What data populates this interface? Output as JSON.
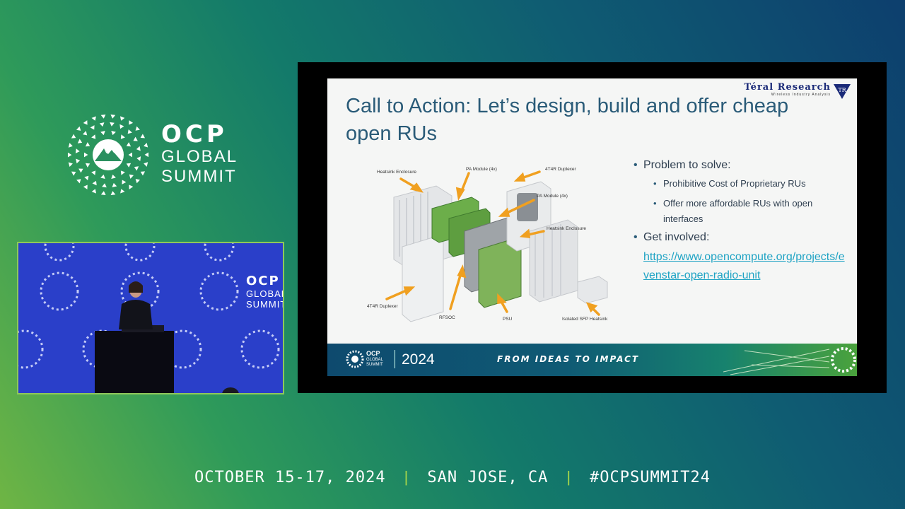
{
  "event_brand": {
    "name": "OCP",
    "line1": "GLOBAL",
    "line2": "SUMMIT"
  },
  "video": {
    "brand_name": "OCP",
    "brand_line1": "GLOBAL",
    "brand_line2": "SUMMIT"
  },
  "slide": {
    "publisher": {
      "name": "Téral Research",
      "tagline": "Wireless Industry Analysis",
      "mark": "TR"
    },
    "title": "Call to Action: Let’s design, build and offer cheap open RUs",
    "diagram_labels": [
      "Heatsink Enclosure",
      "PA Module (4x)",
      "4T4R Duplexer",
      "PA Module (4x)",
      "Heatsink Enclosure",
      "4T4R Duplexer",
      "RFSOC",
      "PSU",
      "Isolated SFP Heatsink"
    ],
    "bullets": {
      "problem_heading": "Problem to solve:",
      "problem_items": [
        "Prohibitive Cost of Proprietary RUs",
        "Offer more affordable RUs with open interfaces"
      ],
      "involve_heading": "Get involved:",
      "link": "https://www.opencompute.org/projects/evenstar-open-radio-unit"
    },
    "footer": {
      "logo_name": "OCP",
      "logo_line1": "GLOBAL",
      "logo_line2": "SUMMIT",
      "year": "2024",
      "slogan": "FROM IDEAS TO IMPACT"
    }
  },
  "bottom_bar": {
    "dates": "OCTOBER 15-17, 2024",
    "location": "SAN JOSE, CA",
    "hashtag": "#OCPSUMMIT24",
    "separator": "|"
  },
  "colors": {
    "accent_green": "#a6d64a",
    "slide_title": "#2a5b78",
    "link": "#1fa3c4",
    "arrow_orange": "#f0a020"
  }
}
